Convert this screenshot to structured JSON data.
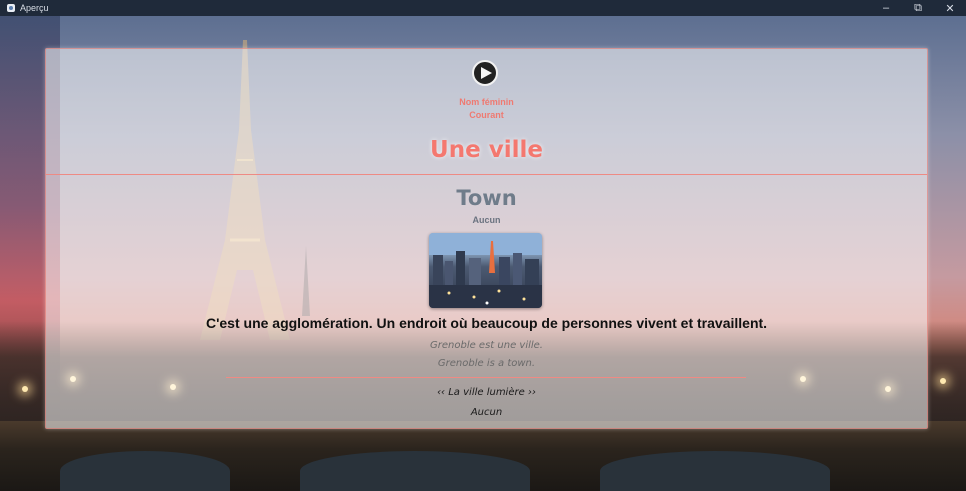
{
  "window": {
    "title": "Aperçu",
    "controls": {
      "minimize": "–",
      "maximize": "⧉",
      "close": "✕"
    }
  },
  "entry": {
    "gender": "Nom féminin",
    "register": "Courant",
    "word": "Une ville",
    "translation": "Town",
    "translation_note": "Aucun",
    "image_icon": "city-photo",
    "definition": "C'est une agglomération. Un endroit où beaucoup de personnes vivent et travaillent.",
    "examples": [
      "Grenoble est une ville.",
      "Grenoble is a town."
    ],
    "expression": "‹‹ La ville lumière ››",
    "expression_note": "Aucun"
  },
  "colors": {
    "accent": "#f4786f",
    "translation": "#6f7c8a"
  }
}
